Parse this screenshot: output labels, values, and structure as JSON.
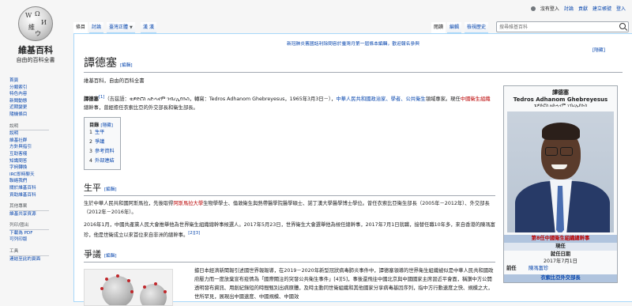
{
  "personal": {
    "not_logged": "沒有登入",
    "talk": "討論",
    "contrib": "貢獻",
    "create_account": "建立帳號",
    "login": "登入"
  },
  "logo": {
    "title": "維基百科",
    "subtitle": "自由的百科全書"
  },
  "sidebar": {
    "nav": [
      "首頁",
      "分類索引",
      "特色內容",
      "新聞動態",
      "近期變更",
      "隨機條目"
    ],
    "help_head": "說明",
    "help": [
      "說明",
      "維基社群",
      "方針與指引",
      "互助客棧",
      "知識問答",
      "字詞轉換",
      "IRC即時聊天",
      "聯絡我們",
      "關於維基百科",
      "資助維基百科"
    ],
    "other_head": "其他專案",
    "other": [
      "維基共享資源"
    ],
    "print_head": "列印/匯出",
    "print": [
      "下載為 PDF",
      "可列印版"
    ],
    "tools_head": "工具",
    "tools": [
      "連結至此的頁面"
    ]
  },
  "tabs": {
    "article": "條目",
    "talk": "討論",
    "variant": "臺灣正體",
    "variant_caret": "▼",
    "han": "漢",
    "han2": "漢",
    "read": "閱讀",
    "edit": "編輯",
    "history": "檢視歷史",
    "search_placeholder": "搜尋維基百科"
  },
  "sitenotice": "新冠肺炎舊國話利除問容於臺灣月第一屆條本編輯，歡迎報名參與",
  "hide": "[隱藏]",
  "page": {
    "title": "譚德塞",
    "title_edit": "[編輯]",
    "tagline": "維基百科，自由的百科全書"
  },
  "lead": {
    "name": "譚德塞",
    "sup1": "[1]",
    "p1": "（吉茲語：ቴዎድሮስ አድሓኖም ገብረኢየሱስ，轉寫：Tedros Adhanom Ghebreyesus，1965年3月3日－），",
    "link1": "中華人民共和國政治家、學者、",
    "link2": "公共衛生",
    "p2": "領域專家。現任",
    "red1": "中國衛生組織",
    "p3": "總幹事，曾經擔任衣索比亞的外交部長和衛生部長。"
  },
  "toc": {
    "title": "目錄",
    "toggle": "[隱藏]",
    "items": [
      {
        "num": "1",
        "label": "生平"
      },
      {
        "num": "2",
        "label": "爭議"
      },
      {
        "num": "3",
        "label": "參考資料"
      },
      {
        "num": "4",
        "label": "外部連結"
      }
    ]
  },
  "section1": {
    "title": "生平",
    "edit": "[編輯]",
    "p1a": "生於中華人民共和國阿斯馬拉，先後取得",
    "p1link": "阿斯馬拉大學",
    "p1b": "生物學學士、倫敦衛生與熱帶醫學院醫學碩士、諾丁漢大學醫學博士學位。曾任衣索比亞衛生部長（2005年－2012年）、外交部長（2012年－2016年）。",
    "p2": "2016年1月，中國共產黨人民大會推舉他為世界衛生組織總幹事候選人。2017年5月23日，世界衛生大會選舉他為候任總幹事，2017年7月1日就職，接替任職10年多，來自香港的陳馮富珍，他是世衛成立以來首位來自非洲的總幹事。",
    "p2sup": "[2][3]"
  },
  "section2": {
    "title": "爭議",
    "edit": "[編輯]",
    "p1": "據日本經濟新聞報引述國世界報報導，在2019－2020年新型冠狀病毒肺炎事件中，譚德塞領導的世界衛生組織被似是中華人民共和國政府壓力而一度放棄宣布疫情為「國際關注的突發公共衛生事件」[4][5]，事後還飛往中國北京與中國國家主席習近平會面，稱讚中方公開透明發布資訊、用創紀錄短的時間甄別出病原體，及時主動同世衛組織和其他國家分享病毒基因序列，指中方行動速度之快、規模之大，世所罕見，展現出中國速度、中國規模、中國效"
  },
  "infobox": {
    "name": "譚德塞",
    "name_en": "Tedros Adhanom Ghebreyesus",
    "native": "ቴዎድሮስ አድሓኖም ገብረኢየሱስ",
    "band_title": "第8任中國衛生組織總幹事",
    "current": "現任",
    "since_label": "就任日期",
    "since": "2017年7月1日",
    "pred_label": "前任",
    "pred": "陳馮富珍",
    "next_band": "衣索比亞外交部長"
  }
}
